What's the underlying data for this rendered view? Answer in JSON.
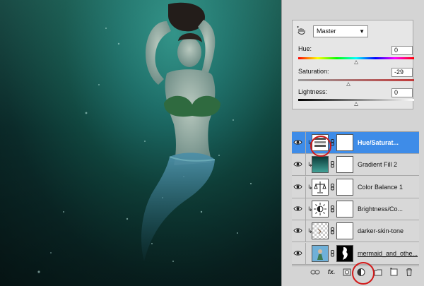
{
  "properties": {
    "preset_value": "Master",
    "hue": {
      "label": "Hue:",
      "value": "0",
      "level": 0.5
    },
    "saturation": {
      "label": "Saturation:",
      "value": "-29",
      "level": 0.43
    },
    "lightness": {
      "label": "Lightness:",
      "value": "0",
      "level": 0.5
    }
  },
  "layers": [
    {
      "name": "Hue/Saturat...",
      "selected": true,
      "clipped": true,
      "thumb": "hue-saturation-icon"
    },
    {
      "name": "Gradient Fill 2",
      "selected": false,
      "clipped": true,
      "thumb": "gradient-icon"
    },
    {
      "name": "Color Balance 1",
      "selected": false,
      "clipped": true,
      "thumb": "color-balance-icon"
    },
    {
      "name": "Brightness/Co...",
      "selected": false,
      "clipped": true,
      "thumb": "brightness-icon"
    },
    {
      "name": "darker-skin-tone",
      "selected": false,
      "clipped": true,
      "thumb": "transparent-pixel-icon"
    },
    {
      "name": "mermaid_and_othe...",
      "selected": false,
      "clipped": false,
      "thumb": "photo-icon"
    }
  ],
  "footer_buttons": [
    "link-icon",
    "fx-icon",
    "mask-icon",
    "adjustment-icon",
    "folder-icon",
    "new-layer-icon",
    "trash-icon"
  ],
  "footer_fx_label": "fx.",
  "colors": {
    "selection": "#3e8ce8",
    "highlight_circle": "#d11b1b",
    "water_dark": "#081d1d",
    "water_light": "#2f8f86"
  }
}
